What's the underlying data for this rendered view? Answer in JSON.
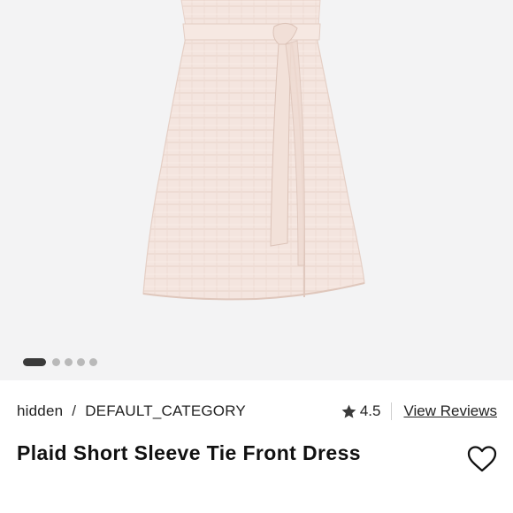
{
  "product_image": {
    "description_icon": "dress-photo",
    "carousel": {
      "total": 5,
      "active_index": 0
    }
  },
  "breadcrumb": {
    "items": [
      "hidden",
      "DEFAULT_CATEGORY"
    ],
    "separator": "/"
  },
  "rating": {
    "icon": "star-icon",
    "value": "4.5",
    "reviews_link": "View Reviews"
  },
  "product": {
    "title": "Plaid Short Sleeve Tie Front Dress"
  },
  "wishlist": {
    "icon": "heart-icon"
  },
  "colors": {
    "background": "#f3f3f4",
    "dress": "#f3e3dc",
    "active_dot": "#3a3a3a",
    "inactive_dot": "#b9b9b9"
  }
}
